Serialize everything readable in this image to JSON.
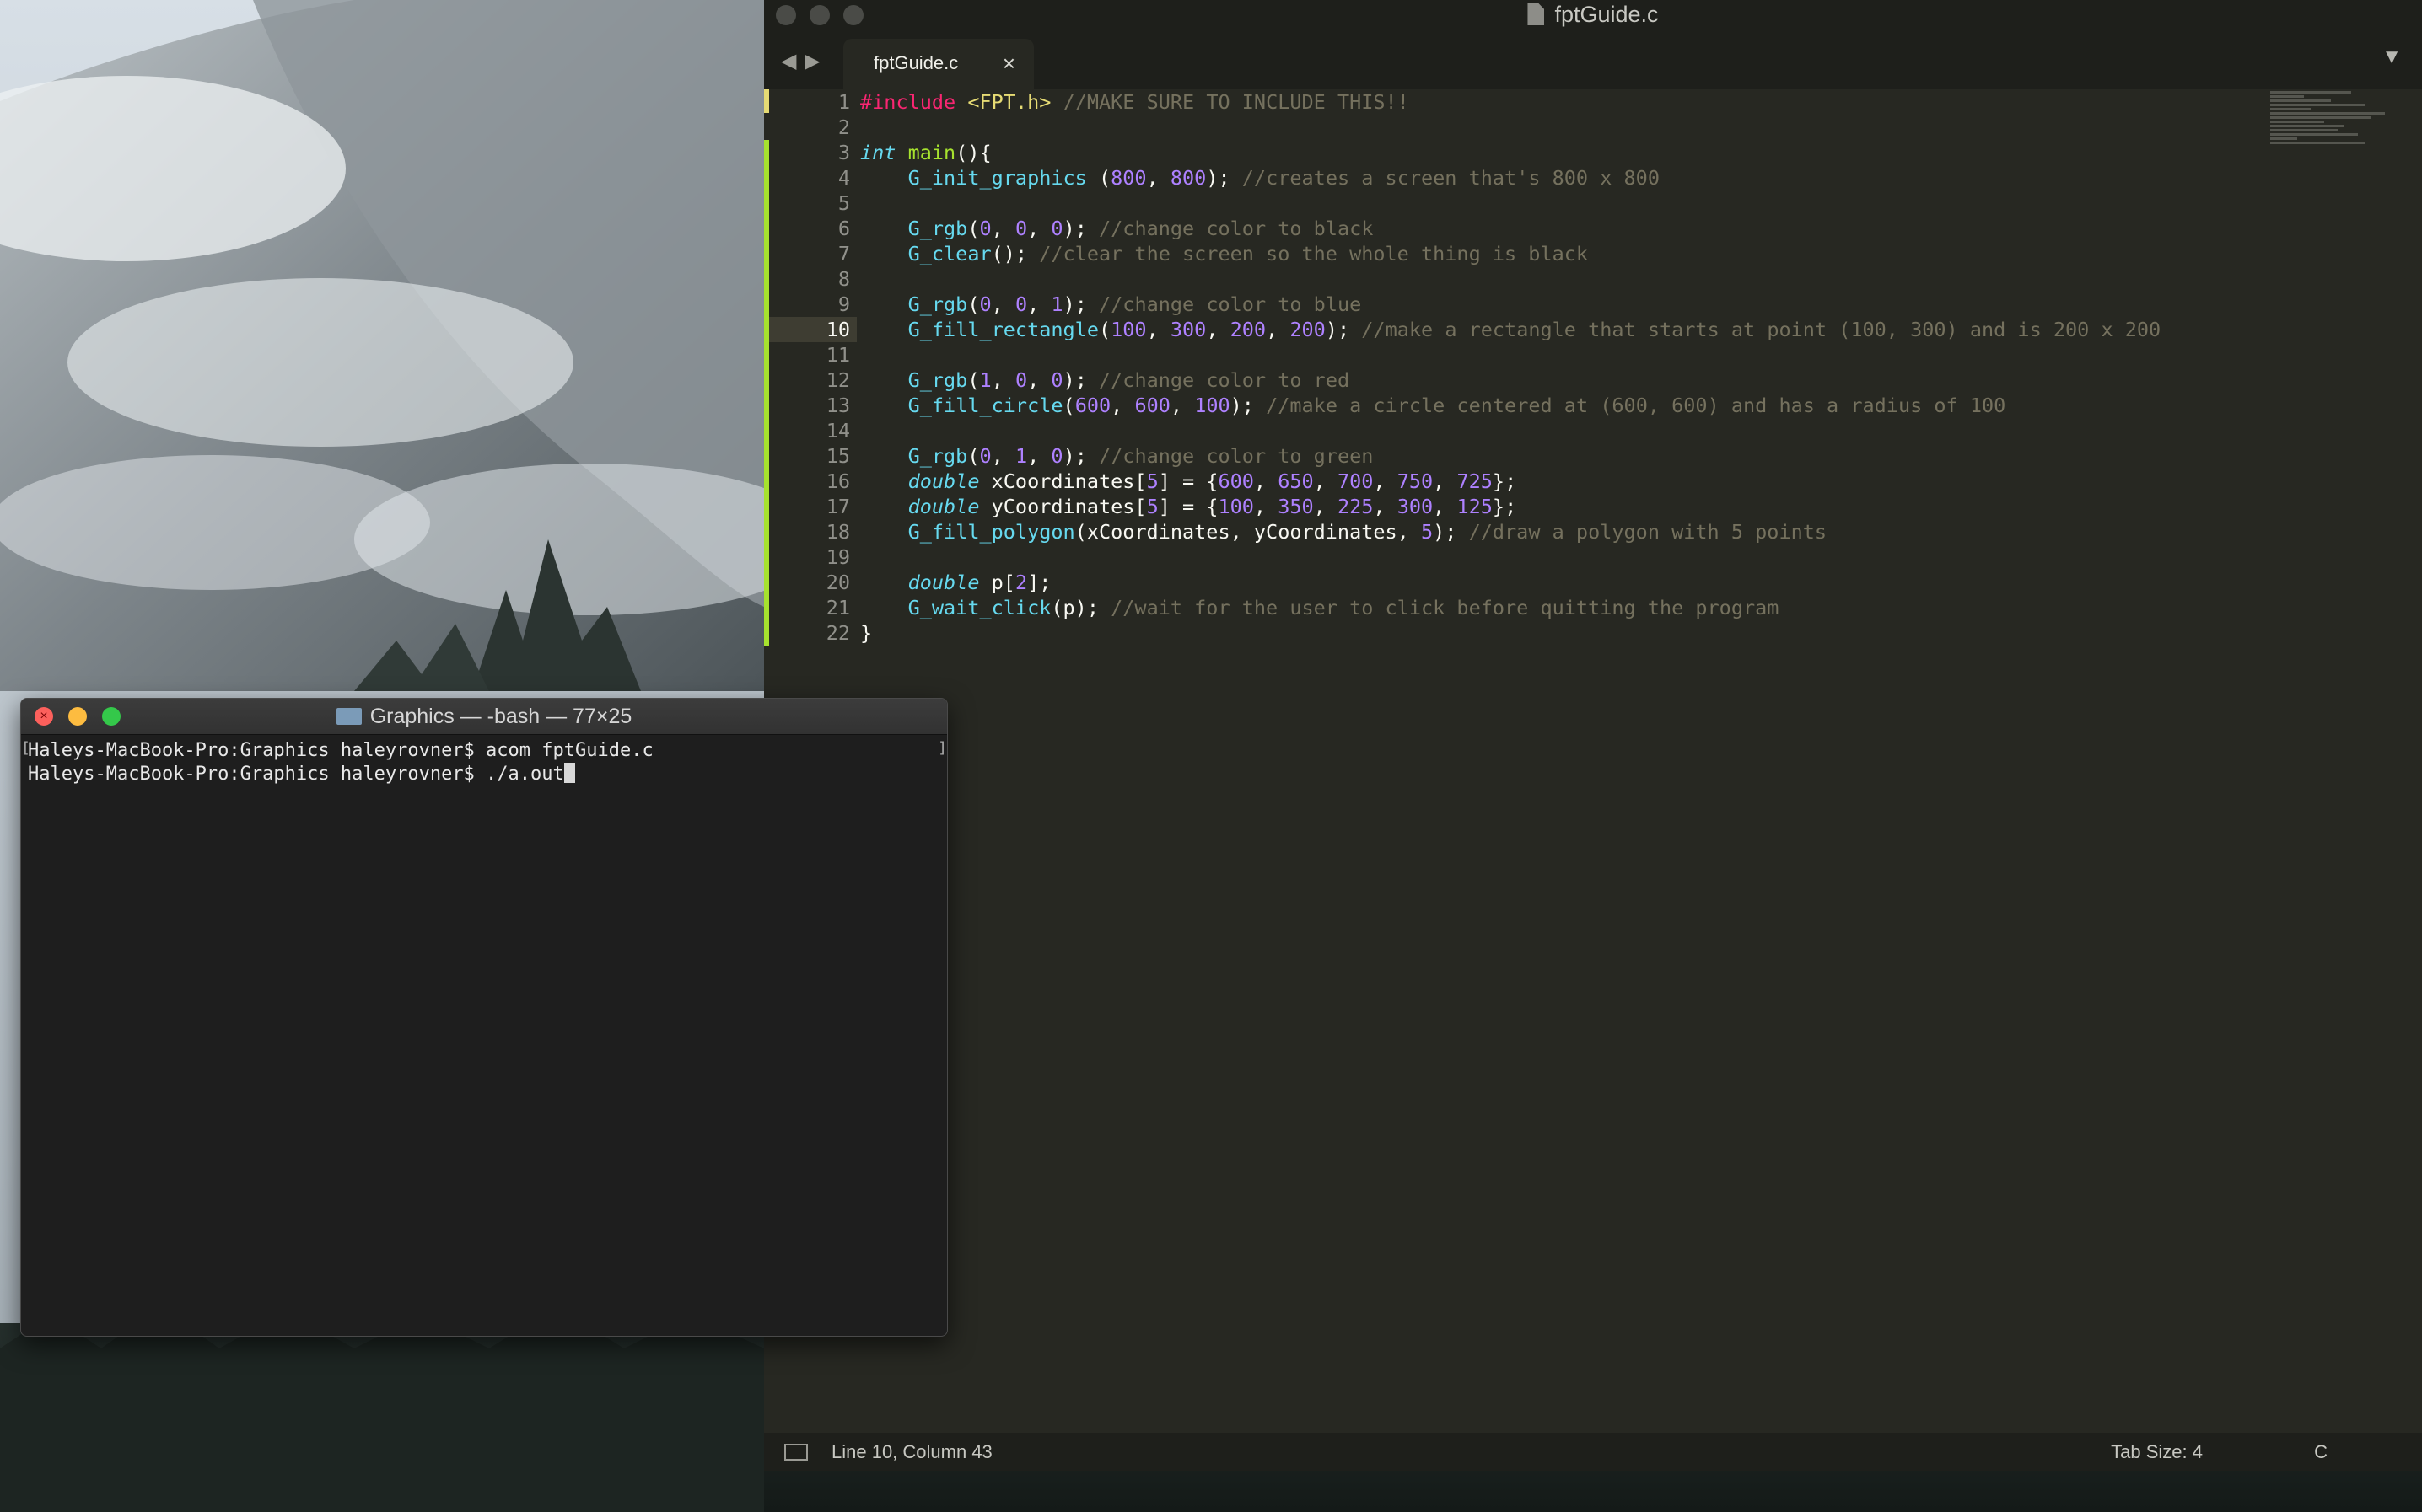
{
  "editor": {
    "window_title": "fptGuide.c",
    "tab_label": "fptGuide.c",
    "tab_close": "×",
    "nav_back": "◀",
    "nav_forward": "▶",
    "tab_menu": "▼",
    "current_line": 10,
    "lines": [
      {
        "n": "1",
        "tokens": [
          [
            "kw",
            "#include"
          ],
          [
            "",
            " "
          ],
          [
            "str",
            "<FPT.h>"
          ],
          [
            "",
            " "
          ],
          [
            "cm",
            "//MAKE SURE TO INCLUDE THIS!!"
          ]
        ]
      },
      {
        "n": "2",
        "tokens": []
      },
      {
        "n": "3",
        "tokens": [
          [
            "ty",
            "int"
          ],
          [
            "",
            " "
          ],
          [
            "fn",
            "main"
          ],
          [
            "",
            "(){"
          ]
        ]
      },
      {
        "n": "4",
        "tokens": [
          [
            "",
            "    "
          ],
          [
            "call",
            "G_init_graphics"
          ],
          [
            "",
            " ("
          ],
          [
            "num",
            "800"
          ],
          [
            "",
            ", "
          ],
          [
            "num",
            "800"
          ],
          [
            "",
            "); "
          ],
          [
            "cm",
            "//creates a screen that's 800 x 800"
          ]
        ]
      },
      {
        "n": "5",
        "tokens": []
      },
      {
        "n": "6",
        "tokens": [
          [
            "",
            "    "
          ],
          [
            "call",
            "G_rgb"
          ],
          [
            "",
            "("
          ],
          [
            "num",
            "0"
          ],
          [
            "",
            ", "
          ],
          [
            "num",
            "0"
          ],
          [
            "",
            ", "
          ],
          [
            "num",
            "0"
          ],
          [
            "",
            "); "
          ],
          [
            "cm",
            "//change color to black"
          ]
        ]
      },
      {
        "n": "7",
        "tokens": [
          [
            "",
            "    "
          ],
          [
            "call",
            "G_clear"
          ],
          [
            "",
            "(); "
          ],
          [
            "cm",
            "//clear the screen so the whole thing is black"
          ]
        ]
      },
      {
        "n": "8",
        "tokens": []
      },
      {
        "n": "9",
        "tokens": [
          [
            "",
            "    "
          ],
          [
            "call",
            "G_rgb"
          ],
          [
            "",
            "("
          ],
          [
            "num",
            "0"
          ],
          [
            "",
            ", "
          ],
          [
            "num",
            "0"
          ],
          [
            "",
            ", "
          ],
          [
            "num",
            "1"
          ],
          [
            "",
            "); "
          ],
          [
            "cm",
            "//change color to blue"
          ]
        ]
      },
      {
        "n": "10",
        "tokens": [
          [
            "",
            "    "
          ],
          [
            "call",
            "G_fill_rectangle"
          ],
          [
            "",
            "("
          ],
          [
            "num",
            "100"
          ],
          [
            "",
            ", "
          ],
          [
            "num",
            "300"
          ],
          [
            "",
            ", "
          ],
          [
            "num",
            "200"
          ],
          [
            "",
            ", "
          ],
          [
            "num",
            "200"
          ],
          [
            "",
            "); "
          ],
          [
            "cm",
            "//make a rectangle that starts at point (100, 300) and is 200 x 200"
          ]
        ]
      },
      {
        "n": "11",
        "tokens": []
      },
      {
        "n": "12",
        "tokens": [
          [
            "",
            "    "
          ],
          [
            "call",
            "G_rgb"
          ],
          [
            "",
            "("
          ],
          [
            "num",
            "1"
          ],
          [
            "",
            ", "
          ],
          [
            "num",
            "0"
          ],
          [
            "",
            ", "
          ],
          [
            "num",
            "0"
          ],
          [
            "",
            "); "
          ],
          [
            "cm",
            "//change color to red"
          ]
        ]
      },
      {
        "n": "13",
        "tokens": [
          [
            "",
            "    "
          ],
          [
            "call",
            "G_fill_circle"
          ],
          [
            "",
            "("
          ],
          [
            "num",
            "600"
          ],
          [
            "",
            ", "
          ],
          [
            "num",
            "600"
          ],
          [
            "",
            ", "
          ],
          [
            "num",
            "100"
          ],
          [
            "",
            "); "
          ],
          [
            "cm",
            "//make a circle centered at (600, 600) and has a radius of 100"
          ]
        ]
      },
      {
        "n": "14",
        "tokens": []
      },
      {
        "n": "15",
        "tokens": [
          [
            "",
            "    "
          ],
          [
            "call",
            "G_rgb"
          ],
          [
            "",
            "("
          ],
          [
            "num",
            "0"
          ],
          [
            "",
            ", "
          ],
          [
            "num",
            "1"
          ],
          [
            "",
            ", "
          ],
          [
            "num",
            "0"
          ],
          [
            "",
            "); "
          ],
          [
            "cm",
            "//change color to green"
          ]
        ]
      },
      {
        "n": "16",
        "tokens": [
          [
            "",
            "    "
          ],
          [
            "ty",
            "double"
          ],
          [
            "",
            " xCoordinates["
          ],
          [
            "num",
            "5"
          ],
          [
            "",
            "] = {"
          ],
          [
            "num",
            "600"
          ],
          [
            "",
            ", "
          ],
          [
            "num",
            "650"
          ],
          [
            "",
            ", "
          ],
          [
            "num",
            "700"
          ],
          [
            "",
            ", "
          ],
          [
            "num",
            "750"
          ],
          [
            "",
            ", "
          ],
          [
            "num",
            "725"
          ],
          [
            "",
            "};"
          ]
        ]
      },
      {
        "n": "17",
        "tokens": [
          [
            "",
            "    "
          ],
          [
            "ty",
            "double"
          ],
          [
            "",
            " yCoordinates["
          ],
          [
            "num",
            "5"
          ],
          [
            "",
            "] = {"
          ],
          [
            "num",
            "100"
          ],
          [
            "",
            ", "
          ],
          [
            "num",
            "350"
          ],
          [
            "",
            ", "
          ],
          [
            "num",
            "225"
          ],
          [
            "",
            ", "
          ],
          [
            "num",
            "300"
          ],
          [
            "",
            ", "
          ],
          [
            "num",
            "125"
          ],
          [
            "",
            "};"
          ]
        ]
      },
      {
        "n": "18",
        "tokens": [
          [
            "",
            "    "
          ],
          [
            "call",
            "G_fill_polygon"
          ],
          [
            "",
            "(xCoordinates, yCoordinates, "
          ],
          [
            "num",
            "5"
          ],
          [
            "",
            "); "
          ],
          [
            "cm",
            "//draw a polygon with 5 points"
          ]
        ]
      },
      {
        "n": "19",
        "tokens": []
      },
      {
        "n": "20",
        "tokens": [
          [
            "",
            "    "
          ],
          [
            "ty",
            "double"
          ],
          [
            "",
            " p["
          ],
          [
            "num",
            "2"
          ],
          [
            "",
            "];"
          ]
        ]
      },
      {
        "n": "21",
        "tokens": [
          [
            "",
            "    "
          ],
          [
            "call",
            "G_wait_click"
          ],
          [
            "",
            "(p); "
          ],
          [
            "cm",
            "//wait for the user to click before quitting the program"
          ]
        ]
      },
      {
        "n": "22",
        "tokens": [
          [
            "",
            "}"
          ]
        ]
      }
    ],
    "status": {
      "position": "Line 10, Column 43",
      "tab_size": "Tab Size: 4",
      "syntax": "C"
    }
  },
  "terminal": {
    "title": "Graphics — -bash — 77×25",
    "close_glyph": "×",
    "lines": [
      "Haleys-MacBook-Pro:Graphics haleyrovner$ acom fptGuide.c",
      "Haleys-MacBook-Pro:Graphics haleyrovner$ ./a.out"
    ]
  },
  "colors": {
    "editor_bg": "#272822",
    "terminal_bg": "#1e1e1e",
    "keyword": "#f92672",
    "string": "#e6db74",
    "comment": "#75715e",
    "number": "#ae81ff",
    "function": "#66d9ef"
  }
}
